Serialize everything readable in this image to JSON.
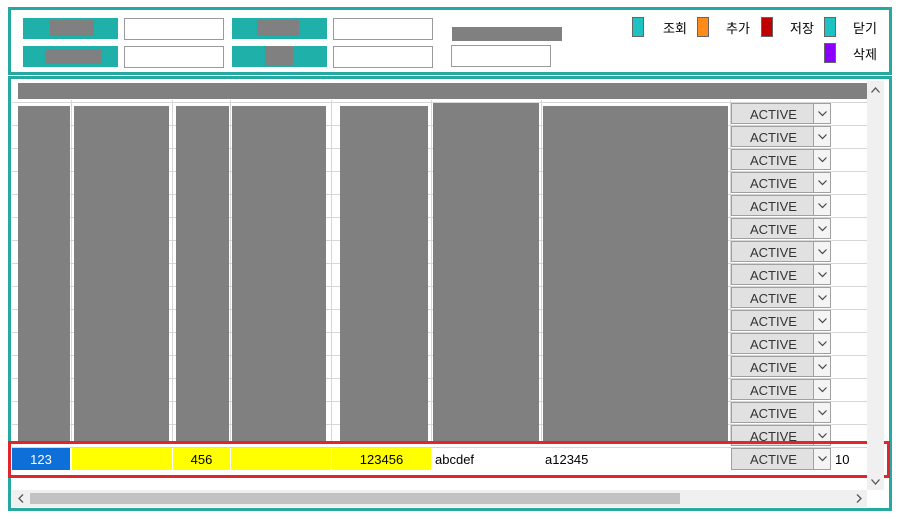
{
  "toolbar": {
    "buttons": [
      {
        "label": "조회",
        "color": "#1fc2c2"
      },
      {
        "label": "추가",
        "color": "#ff8c1a"
      },
      {
        "label": "저장",
        "color": "#c00000"
      },
      {
        "label": "닫기",
        "color": "#1fc2c2"
      },
      {
        "label": "삭제",
        "color": "#8b00ff"
      }
    ]
  },
  "grid": {
    "status_options_visible": "ACTIVE",
    "rows_status": [
      "ACTIVE",
      "ACTIVE",
      "ACTIVE",
      "ACTIVE",
      "ACTIVE",
      "ACTIVE",
      "ACTIVE",
      "ACTIVE",
      "ACTIVE",
      "ACTIVE",
      "ACTIVE",
      "ACTIVE",
      "ACTIVE",
      "ACTIVE",
      "ACTIVE"
    ],
    "selected_row": {
      "col1": "123",
      "col2": "",
      "col3": "456",
      "col4": "",
      "col5": "123456",
      "col6": "abcdef",
      "col7": "a12345",
      "status": "ACTIVE",
      "col9": "10"
    }
  },
  "colors": {
    "panel_border": "#26a9a0",
    "selection_border": "#e0252b",
    "highlight_yellow": "#ffff00",
    "selected_blue": "#0f6fd8"
  }
}
